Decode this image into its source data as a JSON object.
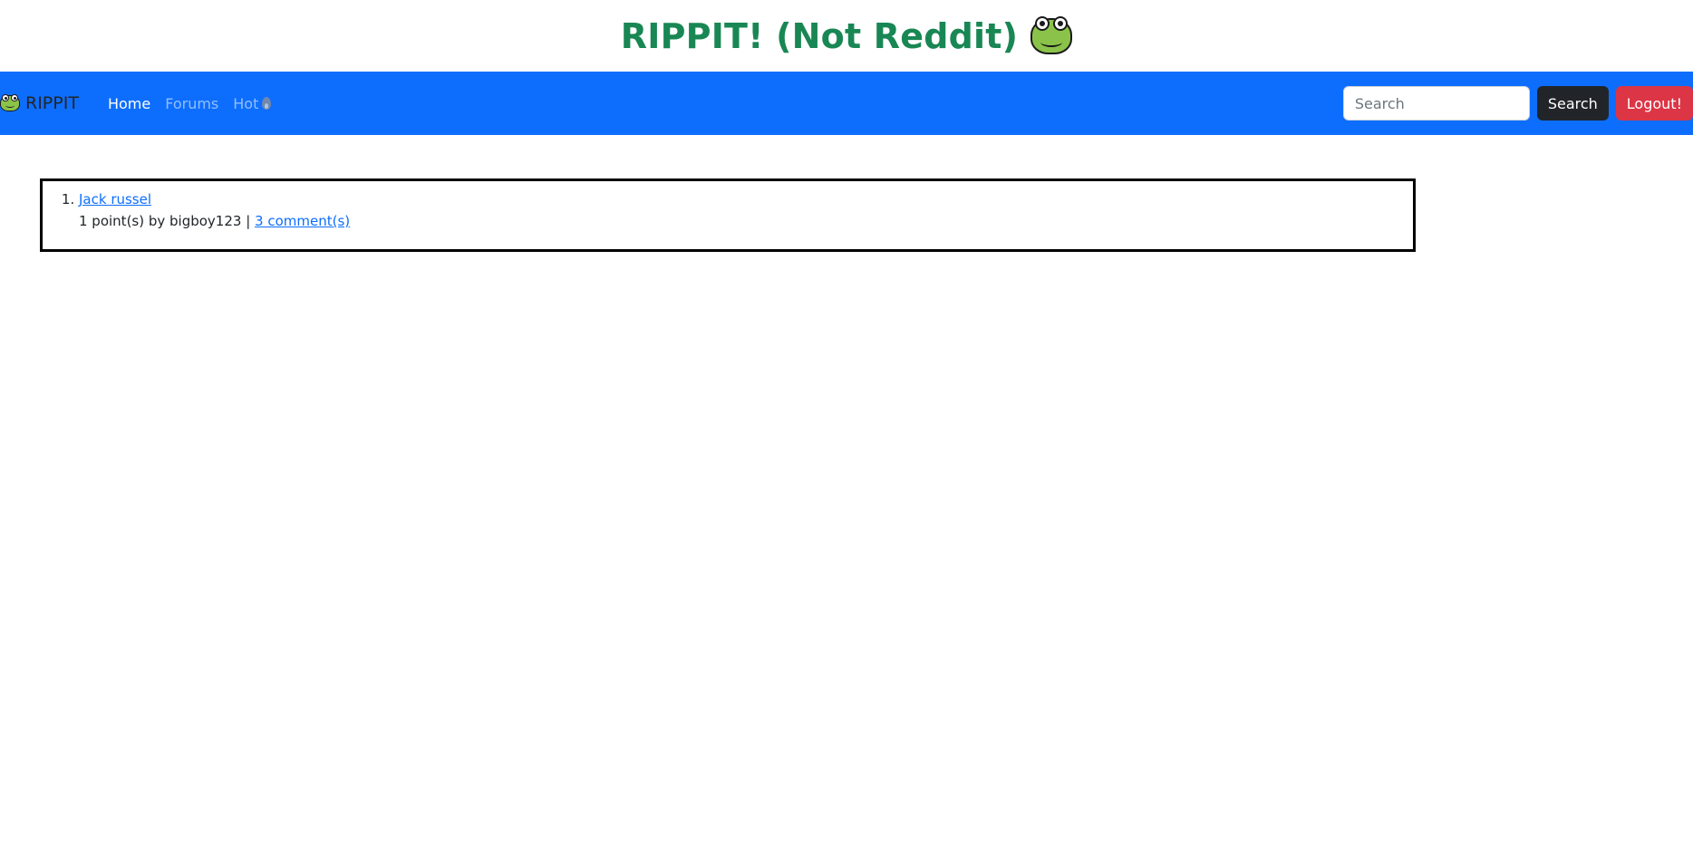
{
  "header": {
    "title": "RIPPIT! (Not Reddit)",
    "title_icon": "frog-face-icon",
    "title_color": "#198754"
  },
  "navbar": {
    "background": "#0d6efd",
    "brand_label": "RIPPIT",
    "brand_icon": "frog-face-icon",
    "links": [
      {
        "label": "Home",
        "active": true
      },
      {
        "label": "Forums",
        "active": false
      },
      {
        "label": "Hot",
        "icon": "fire-icon",
        "active": false
      }
    ],
    "search": {
      "placeholder": "Search",
      "value": "",
      "button_label": "Search"
    },
    "logout_label": "Logout!"
  },
  "posts": [
    {
      "number": "1.",
      "title": "Jack russel",
      "meta_prefix": "1 point(s) by bigboy123 |",
      "comments_label": "3 comment(s)"
    }
  ]
}
